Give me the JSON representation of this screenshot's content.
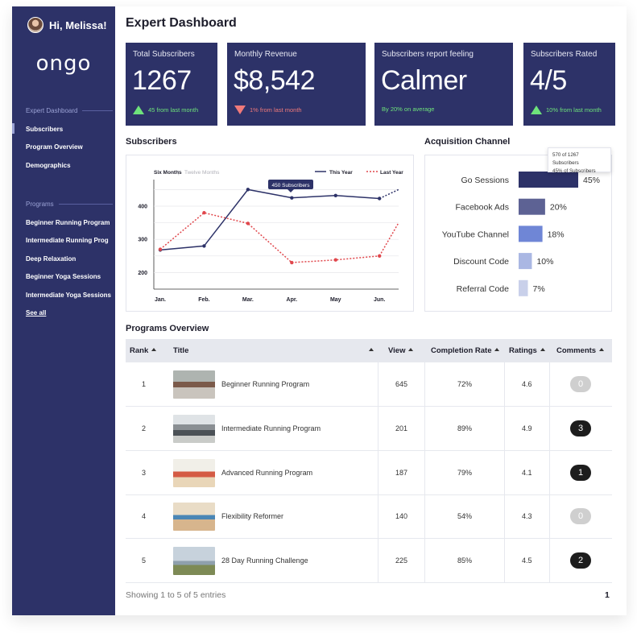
{
  "user": {
    "greeting": "Hi, Melissa!"
  },
  "brand": {
    "logo_text": "ongo",
    "primary_color": "#2d3268",
    "accent_bar": "#6f86d6"
  },
  "sidebar": {
    "dashboard_heading": "Expert Dashboard",
    "dashboard_items": [
      {
        "label": "Subscribers",
        "active": true
      },
      {
        "label": "Program Overview"
      },
      {
        "label": "Demographics"
      }
    ],
    "programs_heading": "Programs",
    "program_items": [
      {
        "label": "Beginner Running Program"
      },
      {
        "label": "Intermediate Running Prog"
      },
      {
        "label": "Deep Relaxation"
      },
      {
        "label": "Beginner Yoga Sessions"
      },
      {
        "label": "Intermediate Yoga Sessions"
      }
    ],
    "see_all": "See all"
  },
  "page": {
    "title": "Expert Dashboard"
  },
  "kpis": [
    {
      "label": "Total Subscribers",
      "value": "1267",
      "delta": "45 from last month",
      "trend": "up"
    },
    {
      "label": "Monthly Revenue",
      "value": "$8,542",
      "delta": "1% from last month",
      "trend": "down"
    },
    {
      "label": "Subscribers report feeling",
      "value": "Calmer",
      "delta": "By 20% on average",
      "trend": "none"
    },
    {
      "label": "Subscribers Rated",
      "value": "4/5",
      "delta": "10% from last month",
      "trend": "up"
    }
  ],
  "subscribers_section": {
    "title": "Subscribers",
    "range_active": "Six Months",
    "range_separator": " | ",
    "range_inactive": "Twelve Months",
    "tooltip": "450 Subscribers"
  },
  "acquisition_section": {
    "title": "Acquisition Channel",
    "tooltip_line1": "570 of 1267 Subscribers",
    "tooltip_line2": "45% of Subscribers"
  },
  "chart_data": [
    {
      "type": "line",
      "title": "Subscribers",
      "categories": [
        "Jan.",
        "Feb.",
        "Mar.",
        "Apr.",
        "May",
        "Jun."
      ],
      "series": [
        {
          "name": "This Year",
          "values": [
            268,
            280,
            450,
            425,
            432,
            423
          ],
          "projection_end": 450,
          "color": "#2d3268",
          "style": "solid"
        },
        {
          "name": "Last Year",
          "values": [
            270,
            380,
            348,
            230,
            238,
            250
          ],
          "projection_end": 350,
          "color": "#e0474c",
          "style": "dotted"
        }
      ],
      "yticks": [
        200,
        300,
        400
      ],
      "ylim": [
        150,
        480
      ],
      "legend": "top-right",
      "grid": true
    },
    {
      "type": "bar",
      "orientation": "horizontal",
      "title": "Acquisition Channel",
      "categories": [
        "Go Sessions",
        "Facebook Ads",
        "YouTube Channel",
        "Discount Code",
        "Referral Code"
      ],
      "values": [
        45,
        20,
        18,
        10,
        7
      ],
      "value_labels": [
        "45%",
        "20%",
        "18%",
        "10%",
        "7%"
      ],
      "colors": [
        "#2d3268",
        "#5d6294",
        "#6f86d6",
        "#aab7e3",
        "#c9d0ea"
      ]
    }
  ],
  "programs_section": {
    "title": "Programs Overview",
    "columns": [
      "Rank",
      "Title",
      "View",
      "Completion Rate",
      "Ratings",
      "Comments"
    ],
    "rows": [
      {
        "rank": "1",
        "title": "Beginner Running Program",
        "view": "645",
        "completion": "72%",
        "rating": "4.6",
        "comments": "0"
      },
      {
        "rank": "2",
        "title": "Intermediate Running Program",
        "view": "201",
        "completion": "89%",
        "rating": "4.9",
        "comments": "3"
      },
      {
        "rank": "3",
        "title": "Advanced Running Program",
        "view": "187",
        "completion": "79%",
        "rating": "4.1",
        "comments": "1"
      },
      {
        "rank": "4",
        "title": "Flexibility Reformer",
        "view": "140",
        "completion": "54%",
        "rating": "4.3",
        "comments": "0"
      },
      {
        "rank": "5",
        "title": "28 Day Running Challenge",
        "view": "225",
        "completion": "85%",
        "rating": "4.5",
        "comments": "2"
      }
    ],
    "footer": "Showing 1 to 5 of 5 entries",
    "page": "1"
  }
}
